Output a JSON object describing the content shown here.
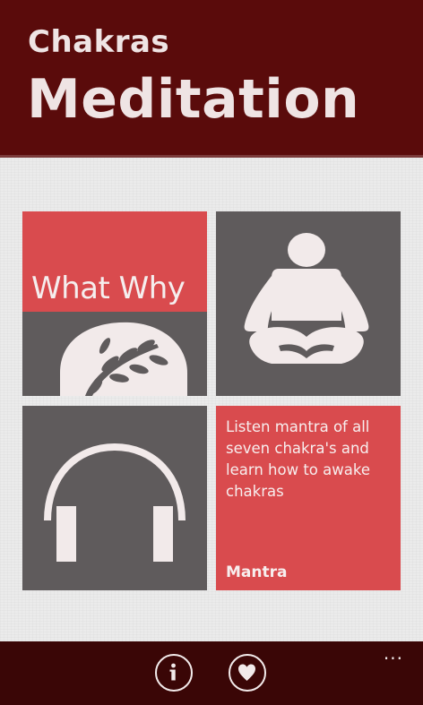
{
  "header": {
    "subtitle": "Chakras",
    "title": "Meditation"
  },
  "tiles": {
    "what_why": {
      "label": "What Why",
      "icon": "tree-icon"
    },
    "meditation": {
      "icon": "meditation-pose-icon"
    },
    "music": {
      "icon": "headphones-icon"
    },
    "mantra": {
      "description": "Listen mantra of all seven chakra's and learn how to awake chakras",
      "title": "Mantra"
    }
  },
  "app_bar": {
    "buttons": [
      {
        "name": "info",
        "icon": "info-icon"
      },
      {
        "name": "favorite",
        "icon": "heart-icon"
      }
    ],
    "more": "..."
  },
  "colors": {
    "header_bg": "#5a0b0b",
    "tile_red": "#d94b4e",
    "tile_gray": "#5f5b5c",
    "appbar_bg": "#3a0606"
  }
}
